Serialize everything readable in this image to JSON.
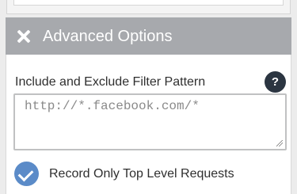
{
  "advanced_options": {
    "title": "Advanced Options",
    "filter_pattern": {
      "label": "Include and Exclude Filter Pattern",
      "help_glyph": "?",
      "placeholder": "http://*.facebook.com/*",
      "value": ""
    },
    "record_top_level": {
      "label": "Record Only Top Level Requests",
      "checked": true
    }
  },
  "colors": {
    "header_bg": "#a7a9ad",
    "help_bg": "#2b3541",
    "check_bg": "#5b8bc8"
  }
}
